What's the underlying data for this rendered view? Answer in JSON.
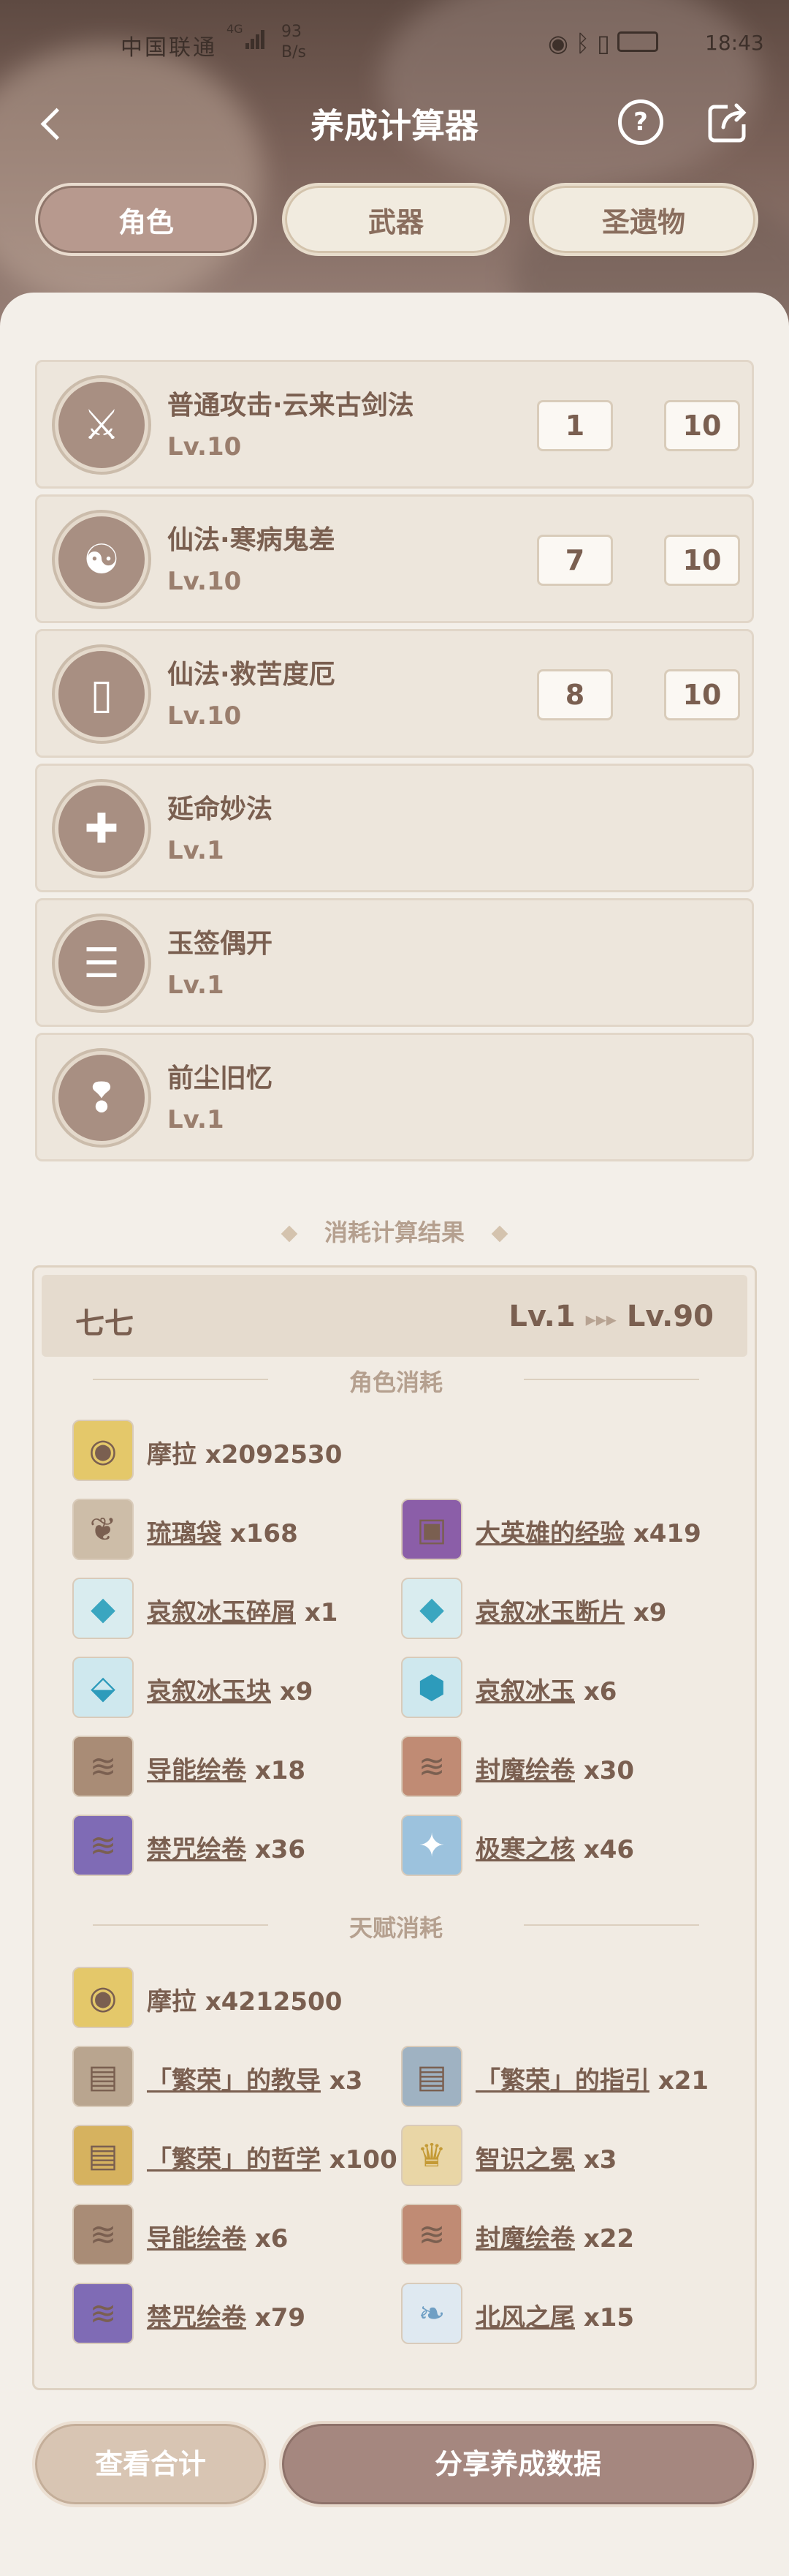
{
  "status_bar": {
    "carrier": "中国联通",
    "net_type": "4G",
    "speed_value": "93",
    "speed_unit": "B/s",
    "time": "18:43",
    "icons": [
      "eye-icon",
      "bluetooth-icon",
      "vibrate-icon",
      "battery-icon"
    ]
  },
  "header": {
    "title": "养成计算器"
  },
  "tabs": [
    {
      "label": "角色",
      "active": true
    },
    {
      "label": "武器",
      "active": false
    },
    {
      "label": "圣遗物",
      "active": false
    }
  ],
  "skills": [
    {
      "name": "普通攻击·云来古剑法",
      "level": "Lv.10",
      "from": "1",
      "to": "10",
      "has_range": true,
      "icon": "sword-icon"
    },
    {
      "name": "仙法·寒病鬼差",
      "level": "Lv.10",
      "from": "7",
      "to": "10",
      "has_range": true,
      "icon": "ghost-icon"
    },
    {
      "name": "仙法·救苦度厄",
      "level": "Lv.10",
      "from": "8",
      "to": "10",
      "has_range": true,
      "icon": "talisman-icon"
    },
    {
      "name": "延命妙法",
      "level": "Lv.1",
      "from": "",
      "to": "",
      "has_range": false,
      "icon": "heal-icon"
    },
    {
      "name": "玉签偶开",
      "level": "Lv.1",
      "from": "",
      "to": "",
      "has_range": false,
      "icon": "scroll-icon"
    },
    {
      "name": "前尘旧忆",
      "level": "Lv.1",
      "from": "",
      "to": "",
      "has_range": false,
      "icon": "pouch-icon"
    }
  ],
  "result": {
    "section_title": "消耗计算结果",
    "character": "七七",
    "level_from": "Lv.1",
    "level_to": "Lv.90",
    "char_section": "角色消耗",
    "char_mora": "摩拉 x2092530",
    "char_items": [
      {
        "name": "琉璃袋",
        "count": "x168"
      },
      {
        "name": "大英雄的经验",
        "count": "x419"
      },
      {
        "name": "哀叙冰玉碎屑",
        "count": "x1"
      },
      {
        "name": "哀叙冰玉断片",
        "count": "x9"
      },
      {
        "name": "哀叙冰玉块",
        "count": "x9"
      },
      {
        "name": "哀叙冰玉",
        "count": "x6"
      },
      {
        "name": "导能绘卷",
        "count": "x18"
      },
      {
        "name": "封魔绘卷",
        "count": "x30"
      },
      {
        "name": "禁咒绘卷",
        "count": "x36"
      },
      {
        "name": "极寒之核",
        "count": "x46"
      }
    ],
    "talent_section": "天赋消耗",
    "talent_mora": "摩拉 x4212500",
    "talent_items": [
      {
        "name": "「繁荣」的教导",
        "count": "x3"
      },
      {
        "name": "「繁荣」的指引",
        "count": "x21"
      },
      {
        "name": "「繁荣」的哲学",
        "count": "x100"
      },
      {
        "name": "智识之冕",
        "count": "x3"
      },
      {
        "name": "导能绘卷",
        "count": "x6"
      },
      {
        "name": "封魔绘卷",
        "count": "x22"
      },
      {
        "name": "禁咒绘卷",
        "count": "x79"
      },
      {
        "name": "北风之尾",
        "count": "x15"
      }
    ]
  },
  "buttons": {
    "total": "查看合计",
    "share": "分享养成数据"
  }
}
